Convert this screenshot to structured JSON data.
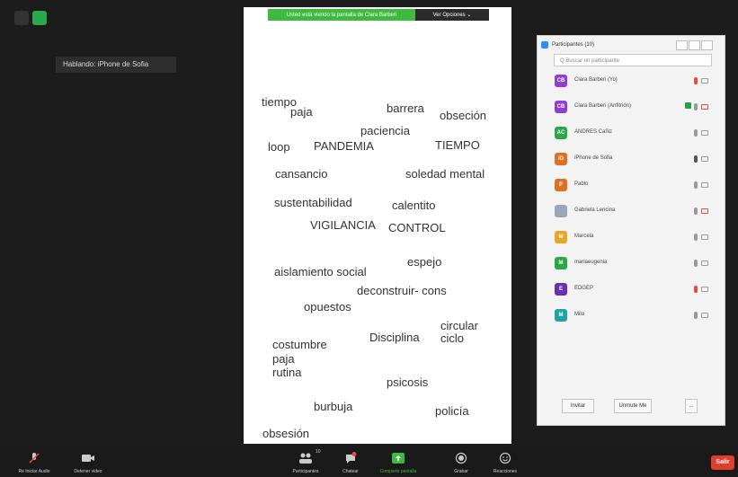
{
  "speaking_label": "Hablando: iPhone de Sofia",
  "share_bar": {
    "status": "Usted está viendo la pantalla de Clara Barberi",
    "options": "Ver Opciones ⌄"
  },
  "word_cloud": [
    "tiempo",
    "paja",
    "barrera",
    "obseción",
    "paciencia",
    "loop",
    "PANDEMIA",
    "TIEMPO",
    "cansancio",
    "soledad mental",
    "sustentabilidad",
    "calentito",
    "VIGILANCIA",
    "CONTROL",
    "espejo",
    "aislamiento social",
    "deconstruir- cons",
    "opuestos",
    "circular",
    "ciclo",
    "costumbre",
    "Disciplina",
    "paja",
    "rutina",
    "psicosis",
    "burbuja",
    "policía",
    "obsesión"
  ],
  "participants_panel": {
    "title": "Participantes (10)",
    "search_placeholder": "Q Buscar un participante",
    "participants": [
      {
        "initials": "CB",
        "name": "Clara Barberi (Yo)",
        "color": "#8e3fd1",
        "mic": "#e84a3b",
        "cam": "#999999",
        "video": false
      },
      {
        "initials": "CB",
        "name": "Clara Barberi (Anfitrión)",
        "color": "#8e3fd1",
        "mic": "#999999",
        "cam": "#e84a3b",
        "video": true
      },
      {
        "initials": "AC",
        "name": "ANDRES Cañiz",
        "color": "#2ca84a",
        "mic": "#999999",
        "cam": "#999999",
        "video": false
      },
      {
        "initials": "iD",
        "name": "iPhone de Sofia",
        "color": "#e07020",
        "mic": "#555555",
        "cam": "#999999",
        "video": false
      },
      {
        "initials": "P",
        "name": "Pablo",
        "color": "#e07020",
        "mic": "#999999",
        "cam": "#999999",
        "video": false
      },
      {
        "initials": "",
        "name": "Gabriela Lencina",
        "color": "#9aa7b5",
        "mic": "#999999",
        "cam": "#e84a3b",
        "video": false
      },
      {
        "initials": "M",
        "name": "Marcela",
        "color": "#e8a623",
        "mic": "#999999",
        "cam": "#999999",
        "video": false
      },
      {
        "initials": "M",
        "name": "mariaeugenia",
        "color": "#2ca84a",
        "mic": "#999999",
        "cam": "#999999",
        "video": false
      },
      {
        "initials": "E",
        "name": "EDGEP",
        "color": "#6a2fb5",
        "mic": "#e84a3b",
        "cam": "#999999",
        "video": false
      },
      {
        "initials": "M",
        "name": "Milo",
        "color": "#1fa3a3",
        "mic": "#999999",
        "cam": "#999999",
        "video": false
      }
    ],
    "invite_label": "Invitar",
    "unmute_label": "Unmute Me",
    "more_label": "..."
  },
  "toolbar": {
    "audio": "Re Iniciar Audio",
    "video": "Detener video",
    "participants": "Participantes",
    "participants_count": "10",
    "chat": "Chatear",
    "share": "Compartir pantalla",
    "record": "Grabar",
    "reactions": "Reacciones",
    "leave": "Salir"
  },
  "colors": {
    "share_green": "#3fb93f",
    "leave_red": "#e03e2d",
    "accent_blue": "#2d8cff",
    "muted_red": "#e84a3b"
  }
}
